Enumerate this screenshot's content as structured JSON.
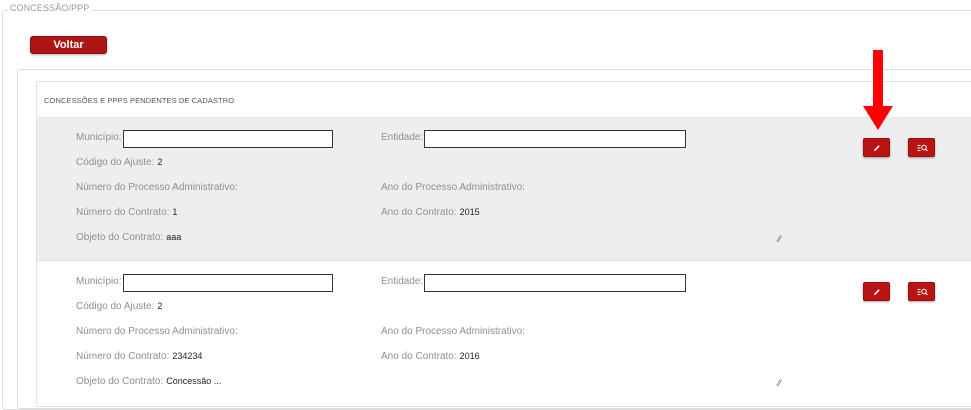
{
  "page": {
    "section_title": "CONCESSÃO/PPP",
    "back_label": "Voltar",
    "list_title": "CONCESSÕES E PPPS PENDENTES DE CADASTRO"
  },
  "labels": {
    "municipio": "Município:",
    "entidade": "Entidade:",
    "codigo_ajuste": "Código do Ajuste:",
    "numero_processo": "Número do Processo Administrativo:",
    "ano_processo": "Ano do Processo Administrativo:",
    "numero_contrato": "Número do Contrato:",
    "ano_contrato": "Ano do Contrato:",
    "objeto_contrato": "Objeto do Contrato:"
  },
  "records": [
    {
      "municipio": "",
      "entidade": "",
      "codigo_ajuste": "2",
      "numero_processo": "",
      "ano_processo": "",
      "numero_contrato": "1",
      "ano_contrato": "2015",
      "objeto_contrato": "aaa"
    },
    {
      "municipio": "",
      "entidade": "",
      "codigo_ajuste": "2",
      "numero_processo": "",
      "ano_processo": "",
      "numero_contrato": "234234",
      "ano_contrato": "2016",
      "objeto_contrato": "Concessão ..."
    }
  ],
  "icons": {
    "edit": "pencil-icon",
    "view": "list-search-icon",
    "annotation": "red-down-arrow"
  },
  "colors": {
    "accent": "#b91414",
    "annotation": "#ff0000",
    "record_highlight_bg": "#eeeeee"
  }
}
